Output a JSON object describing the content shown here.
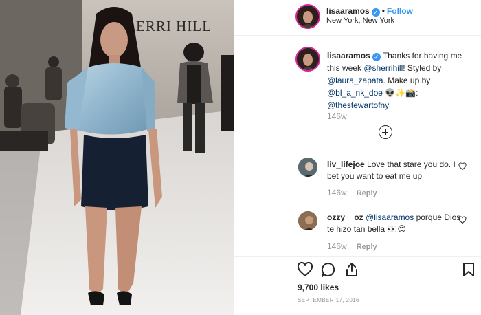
{
  "photo": {
    "wall_text": "ERRI HILL"
  },
  "header": {
    "username": "lisaaramos",
    "verified_mark": "✓",
    "separator": "•",
    "follow_label": "Follow",
    "location": "New York, New York"
  },
  "caption": {
    "username": "lisaaramos",
    "verified_mark": "✓",
    "text_1": "Thanks for having me this week",
    "mention_1": "@sherrihill",
    "text_2": "! Styled by",
    "mention_2": "@laura_zapata",
    "text_3": ". Make up by",
    "mention_3": "@bl_a_nk_doe",
    "emojis": "👽✨📸",
    "text_4": ":",
    "mention_4": "@thestewartofny",
    "timestamp": "146w"
  },
  "comments": [
    {
      "username": "liv_lifejoe",
      "text": "Love that stare you do. I bet you want to eat me up",
      "timestamp": "146w",
      "reply_label": "Reply"
    },
    {
      "username": "ozzy__oz",
      "mention": "@lisaaramos",
      "text": "porque Dios te hizo tan bella",
      "emojis": "👀😍",
      "timestamp": "146w",
      "reply_label": "Reply"
    }
  ],
  "actions": {
    "likes": "9,700 likes",
    "date": "SEPTEMBER 17, 2016"
  },
  "icons": {
    "like": "heart-icon",
    "comment": "comment-icon",
    "share": "share-icon",
    "save": "bookmark-icon",
    "load_more": "plus-circle-icon",
    "verified": "verified-badge-icon"
  },
  "colors": {
    "link": "#3897f0",
    "mention": "#003569",
    "muted": "#999999",
    "text": "#262626",
    "story_ring": "#d6249f"
  }
}
